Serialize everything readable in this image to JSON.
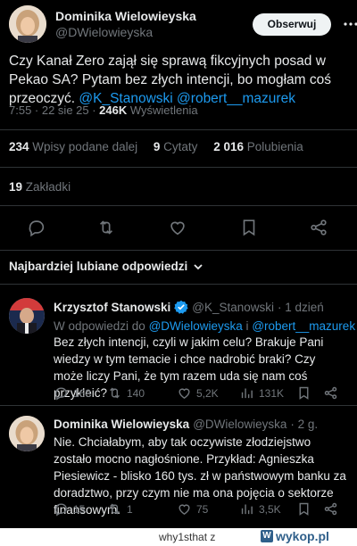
{
  "author": {
    "name": "Dominika Wielowieyska",
    "handle": "@DWielowieyska",
    "follow_label": "Obserwuj"
  },
  "tweet": {
    "text_before": "Czy Kanał Zero zajął się sprawą fikcyjnych posad w Pekao SA? Pytam bez złych intencji, bo mogłam coś przeoczyć. ",
    "mention1": "@K_Stanowski",
    "mention2": "@robert__mazurek",
    "time": "7:55 · 22 sie 25 · ",
    "views_count": "246K",
    "views_label": "Wyświetlenia"
  },
  "stats": {
    "retweets_count": "234",
    "retweets_label": "Wpisy podane dalej",
    "quotes_count": "9",
    "quotes_label": "Cytaty",
    "likes_count": "2 016",
    "likes_label": "Polubienia",
    "bookmarks_count": "19",
    "bookmarks_label": "Zakładki"
  },
  "sort_label": "Najbardziej lubiane odpowiedzi",
  "replies": [
    {
      "name": "Krzysztof Stanowski",
      "handle": "@K_Stanowski",
      "time": "· 1 dzień",
      "reply_to_prefix": "W odpowiedzi do ",
      "reply_to_1": "@DWielowieyska",
      "reply_to_join": " i ",
      "reply_to_2": "@robert__mazurek",
      "text": "Bez złych intencji, czyli w jakim celu? Brakuje Pani wiedzy w tym temacie i chce nadrobić braki? Czy może liczy Pani, że tym razem uda się nam coś przykleić?",
      "replies": "168",
      "retweets": "140",
      "likes": "5,2K",
      "views": "131K"
    },
    {
      "name": "Dominika Wielowieyska",
      "handle": "@DWielowieyska",
      "time": "· 2 g.",
      "text": "Nie. Chciałabym, aby tak oczywiste złodziejstwo zostało mocno  nagłośnione. Przykład: Agnieszka Piesiewicz - blisko 160 tys. zł w państwowym banku za doradztwo, przy czym nie ma ona pojęcia o sektorze finansowym.",
      "replies": "15",
      "retweets": "1",
      "likes": "75",
      "views": "3,5K"
    }
  ],
  "footer": {
    "user": "why1sthat",
    "z": "z",
    "logo_text": "wykop.pl"
  },
  "colors": {
    "background": "#000000",
    "text": "#e7e9ea",
    "muted": "#71767b",
    "link": "#1d9bf0",
    "divider": "#2f3336"
  }
}
